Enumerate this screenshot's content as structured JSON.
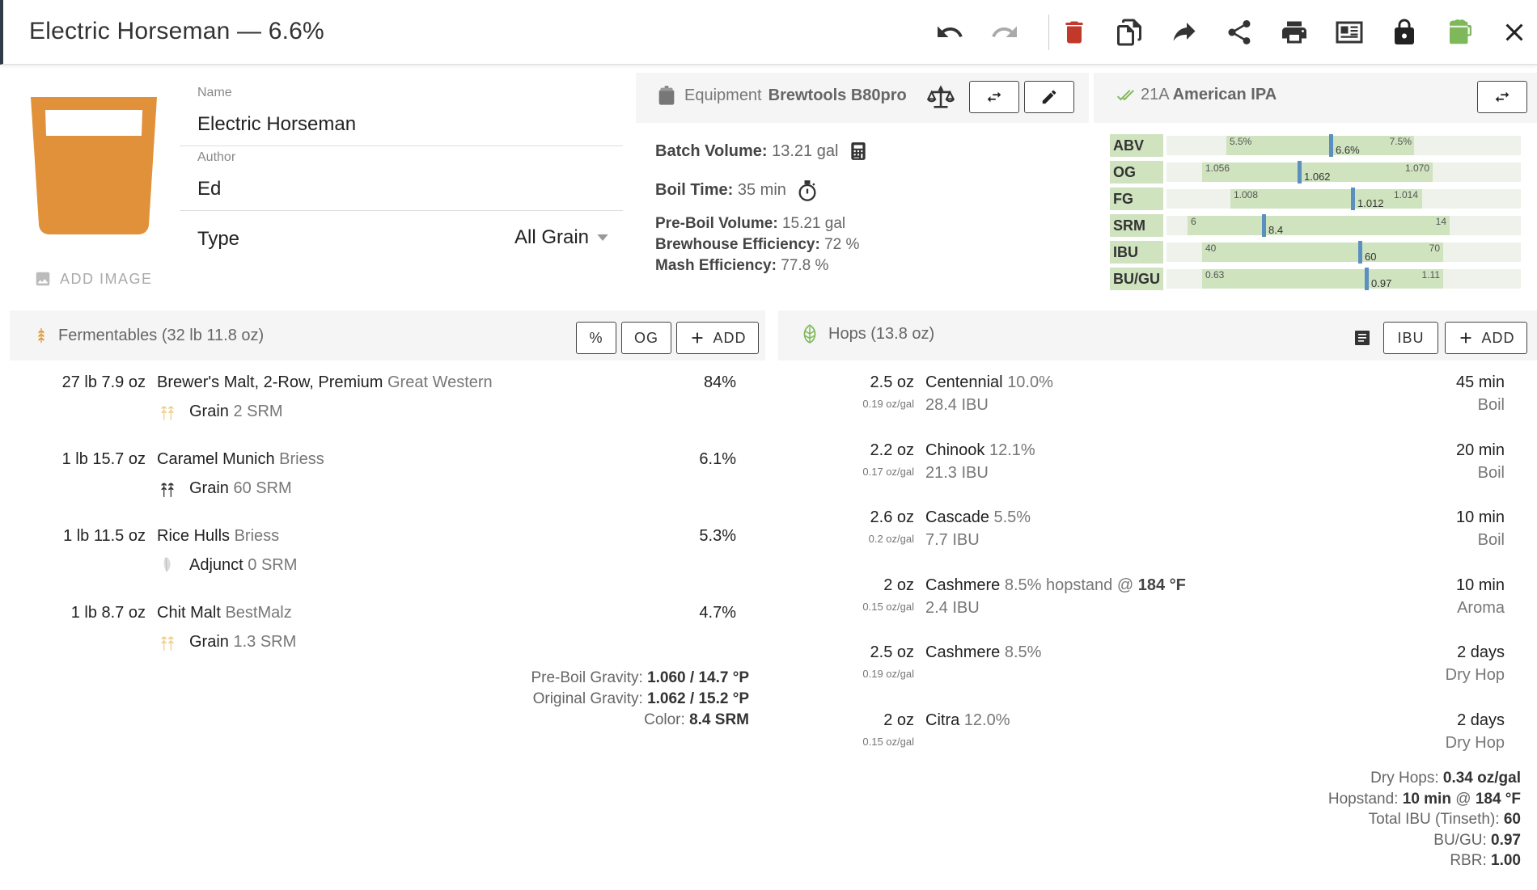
{
  "header": {
    "title": "Electric Horseman — 6.6%"
  },
  "recipe": {
    "name_label": "Name",
    "name": "Electric Horseman",
    "author_label": "Author",
    "author": "Ed",
    "type_label": "Type",
    "type": "All Grain",
    "add_image": "ADD IMAGE"
  },
  "equipment": {
    "label": "Equipment",
    "name": "Brewtools B80pro",
    "batch_label": "Batch Volume:",
    "batch": "13.21 gal",
    "boil_label": "Boil Time:",
    "boil": "35 min",
    "preboil_label": "Pre-Boil Volume:",
    "preboil": "15.21 gal",
    "brewhouse_label": "Brewhouse Efficiency:",
    "brewhouse": "72 %",
    "mash_label": "Mash Efficiency:",
    "mash": "77.8 %"
  },
  "style": {
    "code": "21A",
    "name": "American IPA",
    "ranges": [
      {
        "label": "ABV",
        "min": "5.5%",
        "max": "7.5%",
        "current": "6.6%",
        "min_frac": 0.17,
        "max_frac": 0.7,
        "cur_frac": 0.46
      },
      {
        "label": "OG",
        "min": "1.056",
        "max": "1.070",
        "current": "1.062",
        "min_frac": 0.1,
        "max_frac": 0.75,
        "cur_frac": 0.37
      },
      {
        "label": "FG",
        "min": "1.008",
        "max": "1.014",
        "current": "1.012",
        "min_frac": 0.18,
        "max_frac": 0.72,
        "cur_frac": 0.52
      },
      {
        "label": "SRM",
        "min": "6",
        "max": "14",
        "current": "8.4",
        "min_frac": 0.06,
        "max_frac": 0.8,
        "cur_frac": 0.27
      },
      {
        "label": "IBU",
        "min": "40",
        "max": "70",
        "current": "60",
        "min_frac": 0.1,
        "max_frac": 0.78,
        "cur_frac": 0.54
      },
      {
        "label": "BU/GU",
        "min": "0.63",
        "max": "1.11",
        "current": "0.97",
        "min_frac": 0.1,
        "max_frac": 0.78,
        "cur_frac": 0.56
      }
    ]
  },
  "fermentables": {
    "title": "Fermentables (32 lb 11.8 oz)",
    "btn_pct": "%",
    "btn_og": "OG",
    "btn_add": "ADD",
    "items": [
      {
        "amount": "27 lb 7.9 oz",
        "name": "Brewer's Malt, 2-Row, Premium",
        "supplier": "Great Western",
        "pct": "84%",
        "kind": "Grain",
        "color": "2 SRM"
      },
      {
        "amount": "1 lb 15.7 oz",
        "name": "Caramel Munich",
        "supplier": "Briess",
        "pct": "6.1%",
        "kind": "Grain",
        "color": "60 SRM"
      },
      {
        "amount": "1 lb 11.5 oz",
        "name": "Rice Hulls",
        "supplier": "Briess",
        "pct": "5.3%",
        "kind": "Adjunct",
        "color": "0 SRM"
      },
      {
        "amount": "1 lb 8.7 oz",
        "name": "Chit Malt",
        "supplier": "BestMalz",
        "pct": "4.7%",
        "kind": "Grain",
        "color": "1.3 SRM"
      }
    ],
    "preboil_label": "Pre-Boil Gravity:",
    "preboil": "1.060 / 14.7 °P",
    "og_label": "Original Gravity:",
    "og": "1.062 / 15.2 °P",
    "color_label": "Color:",
    "color": "8.4 SRM"
  },
  "hops": {
    "title": "Hops (13.8 oz)",
    "btn_ibu": "IBU",
    "btn_add": "ADD",
    "items": [
      {
        "amount": "2.5 oz",
        "rate": "0.19 oz/gal",
        "name": "Centennial",
        "alpha": "10.0%",
        "extra": "",
        "ibu": "28.4 IBU",
        "time": "45 min",
        "use": "Boil"
      },
      {
        "amount": "2.2 oz",
        "rate": "0.17 oz/gal",
        "name": "Chinook",
        "alpha": "12.1%",
        "extra": "",
        "ibu": "21.3 IBU",
        "time": "20 min",
        "use": "Boil"
      },
      {
        "amount": "2.6 oz",
        "rate": "0.2 oz/gal",
        "name": "Cascade",
        "alpha": "5.5%",
        "extra": "",
        "ibu": "7.7 IBU",
        "time": "10 min",
        "use": "Boil"
      },
      {
        "amount": "2 oz",
        "rate": "0.15 oz/gal",
        "name": "Cashmere",
        "alpha": "8.5%",
        "extra": "hopstand @",
        "extra_temp": "184 °F",
        "ibu": "2.4 IBU",
        "time": "10 min",
        "use": "Aroma"
      },
      {
        "amount": "2.5 oz",
        "rate": "0.19 oz/gal",
        "name": "Cashmere",
        "alpha": "8.5%",
        "extra": "",
        "ibu": "",
        "time": "2 days",
        "use": "Dry Hop"
      },
      {
        "amount": "2 oz",
        "rate": "0.15 oz/gal",
        "name": "Citra",
        "alpha": "12.0%",
        "extra": "",
        "ibu": "",
        "time": "2 days",
        "use": "Dry Hop"
      }
    ],
    "dry_label": "Dry Hops:",
    "dry": "0.34 oz/gal",
    "hopstand_label": "Hopstand:",
    "hopstand_time": "10 min",
    "hopstand_at": "@",
    "hopstand_temp": "184 °F",
    "total_label": "Total IBU (Tinseth):",
    "total": "60",
    "bugu_label": "BU/GU:",
    "bugu": "0.97",
    "rbr_label": "RBR:",
    "rbr": "1.00"
  },
  "colors": {
    "beer": "#e0913a",
    "range_good": "#cfe3bf",
    "marker": "#5b8fc0",
    "trash": "#c0392b",
    "mug": "#7fb85a"
  }
}
